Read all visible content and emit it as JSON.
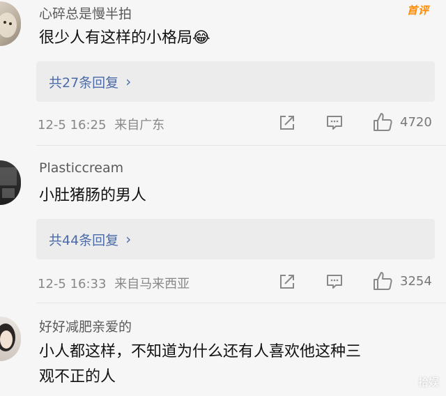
{
  "comments": [
    {
      "username": "心碎总是慢半拍",
      "badge": "首评",
      "text": "很少人有这样的小格局😂",
      "replies_label": "共27条回复",
      "time": "12-5 16:25",
      "location": "来自广东",
      "likes": "4720"
    },
    {
      "username": "Plasticcream",
      "text": "小肚猪肠的男人",
      "replies_label": "共44条回复",
      "time": "12-5 16:33",
      "location": "来自马来西亚",
      "likes": "3254"
    },
    {
      "username": "好好减肥亲爱的",
      "text_line1": "小人都这样，不知道为什么还有人喜欢他这种三",
      "text_line2": "观不正的人"
    }
  ],
  "watermark": "拾娱",
  "icons": {
    "share": "share-icon",
    "comment": "comment-icon",
    "like": "thumbs-up-icon",
    "chevron": "chevron-right-icon"
  },
  "colors": {
    "background": "#f6f6f6",
    "link": "#4b6aa8",
    "badge": "#ff8a00",
    "meta": "#888888"
  }
}
